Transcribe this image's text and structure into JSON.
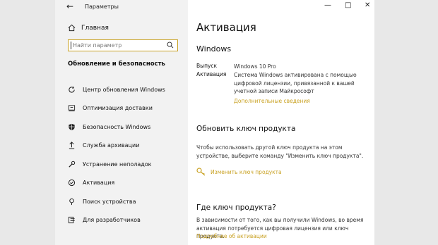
{
  "window": {
    "title": "Параметры",
    "back_glyph": "←",
    "min_glyph": "—",
    "max_glyph": "□",
    "close_glyph": "✕"
  },
  "sidebar": {
    "home_label": "Главная",
    "search_placeholder": "Найти параметр",
    "section_header": "Обновление и безопасность",
    "items": [
      {
        "label": "Центр обновления Windows",
        "icon": "refresh-icon"
      },
      {
        "label": "Оптимизация доставки",
        "icon": "delivery-icon"
      },
      {
        "label": "Безопасность Windows",
        "icon": "shield-icon"
      },
      {
        "label": "Служба архивации",
        "icon": "backup-icon"
      },
      {
        "label": "Устранение неполадок",
        "icon": "wrench-icon"
      },
      {
        "label": "Активация",
        "icon": "activation-icon"
      },
      {
        "label": "Поиск устройства",
        "icon": "find-device-icon"
      },
      {
        "label": "Для разработчиков",
        "icon": "developer-icon"
      }
    ]
  },
  "main": {
    "title": "Активация",
    "section_windows": "Windows",
    "edition_key": "Выпуск",
    "edition_value": "Windows 10 Pro",
    "activation_key": "Активация",
    "activation_value": "Система Windows активирована с помощью цифровой лицензии, привязанной к вашей учетной записи Майкрософт",
    "more_info_link": "Дополнительные сведения",
    "update_key_title": "Обновить ключ продукта",
    "update_key_text": "Чтобы использовать другой ключ продукта на этом устройстве, выберите команду \"Изменить ключ продукта\".",
    "change_key_link": "Изменить ключ продукта",
    "where_key_title": "Где ключ продукта?",
    "where_key_text": "В зависимости от того, как вы получили Windows, во время активация потребуется цифровая лицензия или ключ продукта.",
    "more_about_link": "Подробнее об активации"
  },
  "colors": {
    "accent": "#c9a224",
    "sidebar_bg": "#f2f2f2"
  }
}
